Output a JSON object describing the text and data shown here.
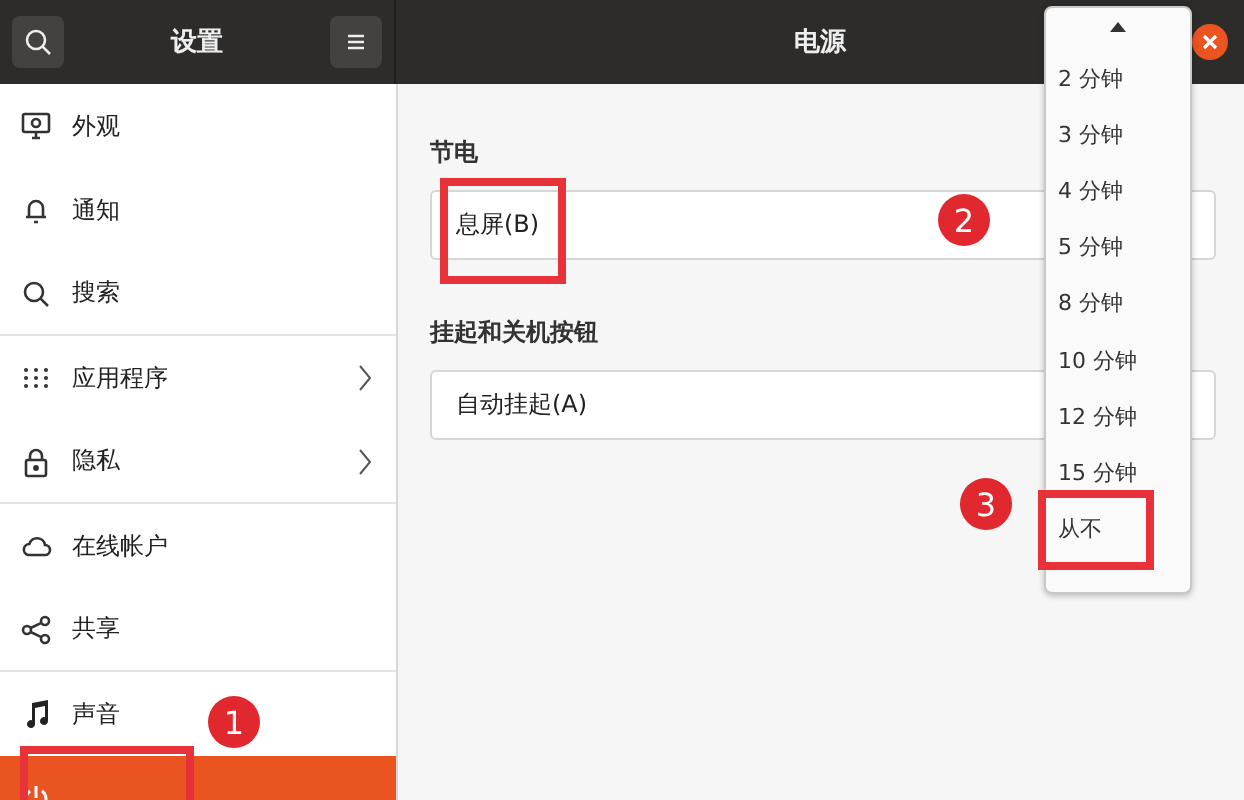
{
  "header": {
    "sidebar_title": "设置",
    "panel_title": "电源"
  },
  "sidebar": {
    "items": [
      {
        "label": "外观",
        "kind": "display",
        "chevron": false,
        "selected": false,
        "group_end": false
      },
      {
        "label": "通知",
        "kind": "bell",
        "chevron": false,
        "selected": false,
        "group_end": false
      },
      {
        "label": "搜索",
        "kind": "search",
        "chevron": false,
        "selected": false,
        "group_end": true
      },
      {
        "label": "应用程序",
        "kind": "grid",
        "chevron": true,
        "selected": false,
        "group_end": false
      },
      {
        "label": "隐私",
        "kind": "lock",
        "chevron": true,
        "selected": false,
        "group_end": true
      },
      {
        "label": "在线帐户",
        "kind": "cloud",
        "chevron": false,
        "selected": false,
        "group_end": false
      },
      {
        "label": "共享",
        "kind": "share",
        "chevron": false,
        "selected": false,
        "group_end": true
      },
      {
        "label": "声音",
        "kind": "note",
        "chevron": false,
        "selected": false,
        "group_end": false
      },
      {
        "kind": "power",
        "chevron": false,
        "selected": true,
        "group_end": false
      }
    ]
  },
  "sections": [
    {
      "title": "节电",
      "rows": [
        {
          "label": "息屏(B)"
        }
      ]
    },
    {
      "title": "挂起和关机按钮",
      "rows": [
        {
          "label": "自动挂起(A)"
        }
      ]
    }
  ],
  "popup": {
    "items": [
      "2 分钟",
      "3 分钟",
      "4 分钟",
      "5 分钟",
      "8 分钟",
      "10 分钟",
      "12 分钟",
      "15 分钟",
      "从不"
    ]
  },
  "annotations": [
    {
      "kind": "circle",
      "label": "1"
    },
    {
      "kind": "box"
    },
    {
      "kind": "circle",
      "label": "2"
    },
    {
      "kind": "box"
    },
    {
      "kind": "circle",
      "label": "3"
    },
    {
      "kind": "box"
    }
  ]
}
